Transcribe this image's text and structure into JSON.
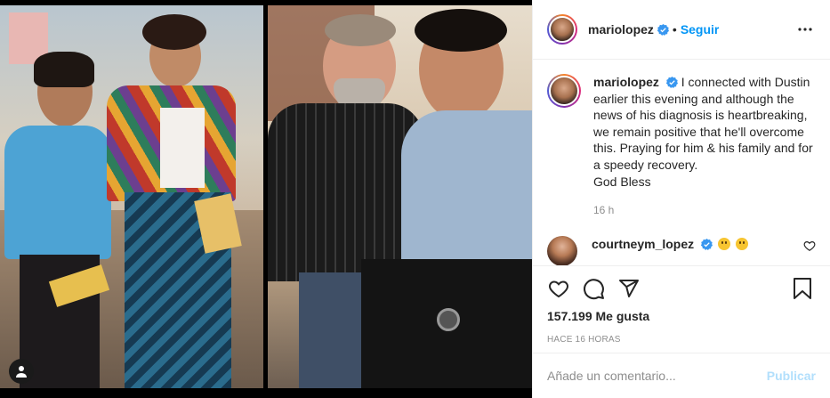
{
  "header": {
    "username": "mariolopez",
    "separator": "•",
    "follow_label": "Seguir",
    "verified_icon": "verified-badge-icon",
    "more_icon": "more-options-icon"
  },
  "caption": {
    "username": "mariolopez",
    "text": "I connected with Dustin earlier this evening and although the news of his diagnosis is heartbreaking, we remain positive that he'll overcome this. Praying for him & his family and for a speedy recovery.",
    "signoff": "God Bless",
    "time": "16 h"
  },
  "comments": [
    {
      "username": "courtneym_lopez",
      "emojis": [
        "sad-face-emoji",
        "sad-face-emoji"
      ]
    }
  ],
  "actions": {
    "likes": "157.199 Me gusta",
    "posted_ago": "HACE 16 HORAS"
  },
  "composer": {
    "placeholder": "Añade un comentario...",
    "post_label": "Publicar"
  },
  "colors": {
    "accent": "#0095f6",
    "post_disabled": "#b2dffc",
    "muted": "#8e8e8e",
    "border": "#efefef"
  }
}
